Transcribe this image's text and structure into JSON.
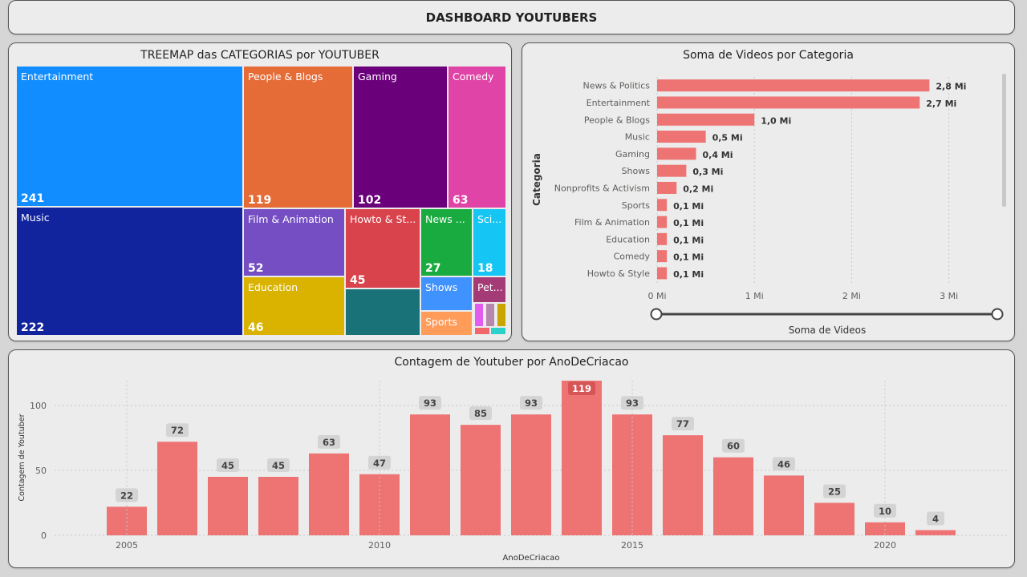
{
  "dashboard": {
    "title": "DASHBOARD YOUTUBERS"
  },
  "treemap": {
    "title": "TREEMAP das CATEGORIAS por YOUTUBER",
    "tiles": [
      {
        "label": "Entertainment",
        "value": "241",
        "color": "#118dff"
      },
      {
        "label": "People & Blogs",
        "value": "119",
        "color": "#e66c37"
      },
      {
        "label": "Gaming",
        "value": "102",
        "color": "#6b007b"
      },
      {
        "label": "Comedy",
        "value": "63",
        "color": "#e044a7"
      },
      {
        "label": "Music",
        "value": "222",
        "color": "#12239e"
      },
      {
        "label": "Film & Animation",
        "value": "52",
        "color": "#744ec2"
      },
      {
        "label": "Howto & St...",
        "value": "45",
        "color": "#d9434c"
      },
      {
        "label": "News ...",
        "value": "27",
        "color": "#1aab40"
      },
      {
        "label": "Sci...",
        "value": "18",
        "color": "#15c6f4"
      },
      {
        "label": "Education",
        "value": "46",
        "color": "#d9b300"
      },
      {
        "label": "",
        "value": "",
        "color": "#197278"
      },
      {
        "label": "Shows",
        "value": "",
        "color": "#4092ff"
      },
      {
        "label": "Pet...",
        "value": "",
        "color": "#a43b76"
      },
      {
        "label": "Sports",
        "value": "",
        "color": "#ff9c5a"
      }
    ],
    "small_colors": [
      "#e35cf0",
      "#b887ad",
      "#c9a500",
      "#f0686b",
      "#2ad2c9"
    ]
  },
  "bar_chart": {
    "title": "Soma de Videos por Categoria",
    "slider": {
      "min": 0,
      "max": 3.3
    }
  },
  "column_chart": {
    "title": "Contagem de Youtuber por AnoDeCriacao"
  },
  "chart_data": [
    {
      "type": "bar",
      "title": "Soma de Videos por Categoria",
      "ylabel": "Categoria",
      "xlabel": "Soma de Videos",
      "categories": [
        "News & Politics",
        "Entertainment",
        "People & Blogs",
        "Music",
        "Gaming",
        "Shows",
        "Nonprofits & Activism",
        "Sports",
        "Film & Animation",
        "Education",
        "Comedy",
        "Howto & Style"
      ],
      "values": [
        2.8,
        2.7,
        1.0,
        0.5,
        0.4,
        0.3,
        0.2,
        0.1,
        0.1,
        0.1,
        0.1,
        0.1
      ],
      "data_labels": [
        "2,8 Mi",
        "2,7 Mi",
        "1,0 Mi",
        "0,5 Mi",
        "0,4 Mi",
        "0,3 Mi",
        "0,2 Mi",
        "0,1 Mi",
        "0,1 Mi",
        "0,1 Mi",
        "0,1 Mi",
        "0,1 Mi"
      ],
      "xticks": [
        0,
        1,
        2,
        3
      ],
      "xtick_labels": [
        "0 Mi",
        "1 Mi",
        "2 Mi",
        "3 Mi"
      ],
      "xlim": [
        0,
        3.3
      ],
      "color": "#ee7373",
      "grid": true
    },
    {
      "type": "bar",
      "title": "Contagem de Youtuber por AnoDeCriacao",
      "xlabel": "AnoDeCriacao",
      "ylabel": "Contagem de Youtuber",
      "x": [
        2005,
        2006,
        2007,
        2008,
        2009,
        2010,
        2011,
        2012,
        2013,
        2014,
        2015,
        2016,
        2017,
        2018,
        2019,
        2020,
        2021
      ],
      "values": [
        22,
        72,
        45,
        45,
        63,
        47,
        93,
        85,
        93,
        119,
        93,
        77,
        60,
        46,
        25,
        10,
        4
      ],
      "highlight": 2014,
      "yticks": [
        0,
        50,
        100
      ],
      "xticks": [
        2005,
        2010,
        2015,
        2020
      ],
      "ylim": [
        0,
        119
      ],
      "color": "#ee7373",
      "grid": true
    }
  ]
}
